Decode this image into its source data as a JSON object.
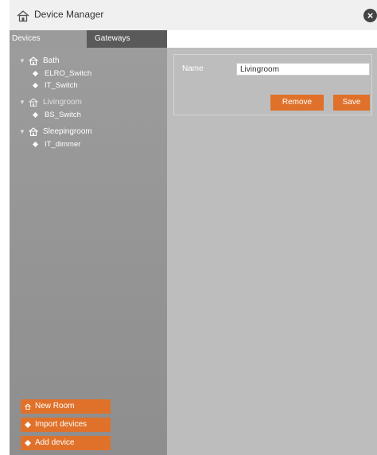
{
  "window": {
    "title": "Device Manager",
    "close_icon": "close-icon",
    "app_icon": "house-icon"
  },
  "tabs": [
    {
      "label": "Devices",
      "active": true
    },
    {
      "label": "Gateways",
      "active": false
    }
  ],
  "tree": {
    "rooms": [
      {
        "label": "Bath",
        "expanded": true,
        "devices": [
          {
            "label": "ELRO_Switch"
          },
          {
            "label": "IT_Switch"
          }
        ]
      },
      {
        "label": "Livingroom",
        "expanded": true,
        "selected": true,
        "devices": [
          {
            "label": "BS_Switch"
          }
        ]
      },
      {
        "label": "Sleepingroom",
        "expanded": true,
        "devices": [
          {
            "label": "IT_dimmer"
          }
        ]
      }
    ]
  },
  "sidebar_buttons": {
    "new_room": "New Room",
    "import_devices": "Import devices",
    "add_device": "Add device"
  },
  "detail": {
    "name_label": "Name",
    "name_value": "Livingroom",
    "remove_label": "Remove",
    "save_label": "Save"
  },
  "colors": {
    "accent": "#e0712a",
    "sidebar": "#9c9c9c",
    "content_bg": "#bdbdbd"
  }
}
